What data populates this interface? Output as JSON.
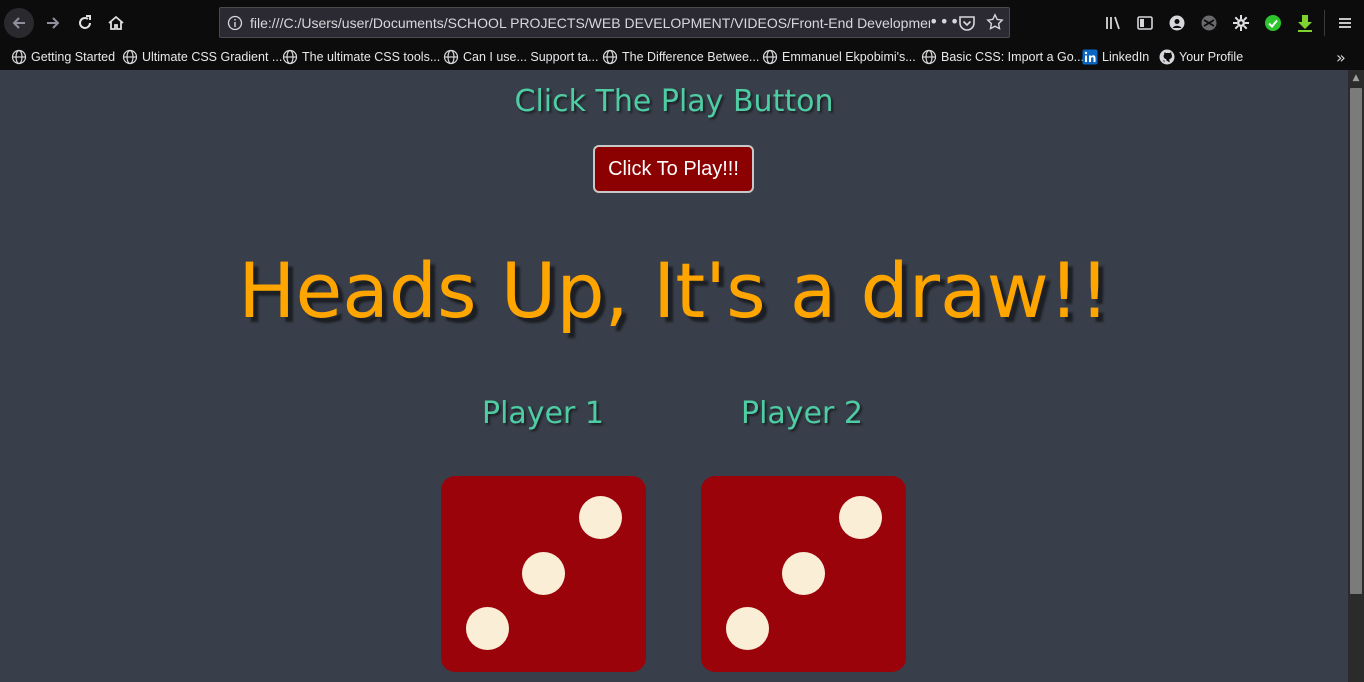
{
  "browser": {
    "url_main": "file:///C:/Users/user/Documents/SCHOOL PROJECTS/WEB DEVELOPMENT/VIDEOS/Front-End Development ",
    "url_faded": "(c",
    "url_dots": "•••",
    "bookmarks": [
      {
        "label": "Getting Started",
        "icon": "globe-icon"
      },
      {
        "label": "Ultimate CSS Gradient ...",
        "icon": "globe-icon"
      },
      {
        "label": "The ultimate CSS tools...",
        "icon": "globe-icon"
      },
      {
        "label": "Can I use... Support ta...",
        "icon": "globe-icon"
      },
      {
        "label": "The Difference Betwee...",
        "icon": "globe-icon"
      },
      {
        "label": "Emmanuel Ekpobimi's...",
        "icon": "globe-icon"
      },
      {
        "label": "Basic CSS: Import a Go...",
        "icon": "globe-icon"
      },
      {
        "label": "LinkedIn",
        "icon": "linkedin-icon"
      },
      {
        "label": "Your Profile",
        "icon": "github-icon"
      }
    ]
  },
  "game": {
    "instruction": "Click The Play Button",
    "play_button_label": "Click To Play!!!",
    "result": "Heads Up, It's a draw!!",
    "players": [
      {
        "label": "Player 1",
        "die_value": 3
      },
      {
        "label": "Player 2",
        "die_value": 3
      }
    ]
  },
  "colors": {
    "page_background": "#393f4a",
    "heading_accent": "#4ecca3",
    "result_text": "#ffa500",
    "button_background": "#8b0000",
    "die_face": "#9b030b",
    "die_pip": "#faefd6"
  }
}
